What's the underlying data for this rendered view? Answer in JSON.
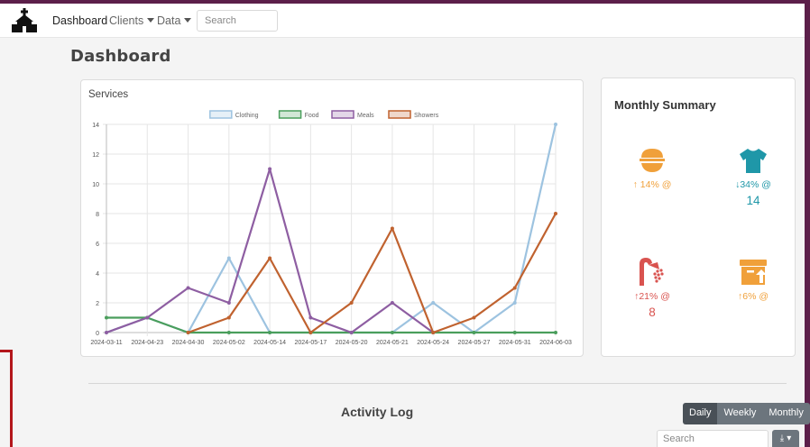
{
  "nav": {
    "dashboard": "Dashboard",
    "clients": "Clients",
    "data": "Data",
    "search_placeholder": "Search"
  },
  "page_title": "Dashboard",
  "services_title": "Services",
  "chart_data": {
    "type": "line",
    "x": [
      "2024-03-11",
      "2024-04-23",
      "2024-04-30",
      "2024-05-02",
      "2024-05-14",
      "2024-05-17",
      "2024-05-20",
      "2024-05-21",
      "2024-05-24",
      "2024-05-27",
      "2024-05-31",
      "2024-06-03"
    ],
    "ylim": [
      0,
      14
    ],
    "yticks": [
      0,
      2,
      4,
      6,
      8,
      10,
      12,
      14
    ],
    "grid": true,
    "legend_position": "top",
    "series": [
      {
        "name": "Clothing",
        "color": "#9dc3e0",
        "values": [
          0,
          1,
          0,
          5,
          0,
          0,
          0,
          0,
          2,
          0,
          2,
          14
        ]
      },
      {
        "name": "Food",
        "color": "#4a9e5c",
        "values": [
          1,
          1,
          0,
          0,
          0,
          0,
          0,
          0,
          0,
          0,
          0,
          0
        ]
      },
      {
        "name": "Meals",
        "color": "#8e5ea2",
        "values": [
          0,
          1,
          3,
          2,
          11,
          1,
          0,
          2,
          0,
          null,
          null,
          null
        ]
      },
      {
        "name": "Showers",
        "color": "#c0622f",
        "values": [
          null,
          null,
          0,
          1,
          5,
          0,
          2,
          7,
          0,
          1,
          3,
          8
        ]
      }
    ]
  },
  "summary": {
    "title": "Monthly Summary",
    "items": [
      {
        "icon": "food-bowl-icon",
        "pct": "14% @",
        "direction": "up",
        "value": "",
        "color": "#f0a03a"
      },
      {
        "icon": "tshirt-icon",
        "pct": "34% @",
        "direction": "down",
        "value": "14",
        "color": "#1f97a8"
      },
      {
        "icon": "shower-icon",
        "pct": "21% @",
        "direction": "up",
        "value": "8",
        "color": "#d9534f"
      },
      {
        "icon": "box-arrow-icon",
        "pct": "6% @",
        "direction": "up",
        "value": "",
        "color": "#f0a03a"
      }
    ]
  },
  "activity": {
    "title": "Activity Log",
    "tabs": [
      "Daily",
      "Weekly",
      "Monthly"
    ],
    "active_tab": "Daily",
    "search_placeholder": "Search"
  }
}
